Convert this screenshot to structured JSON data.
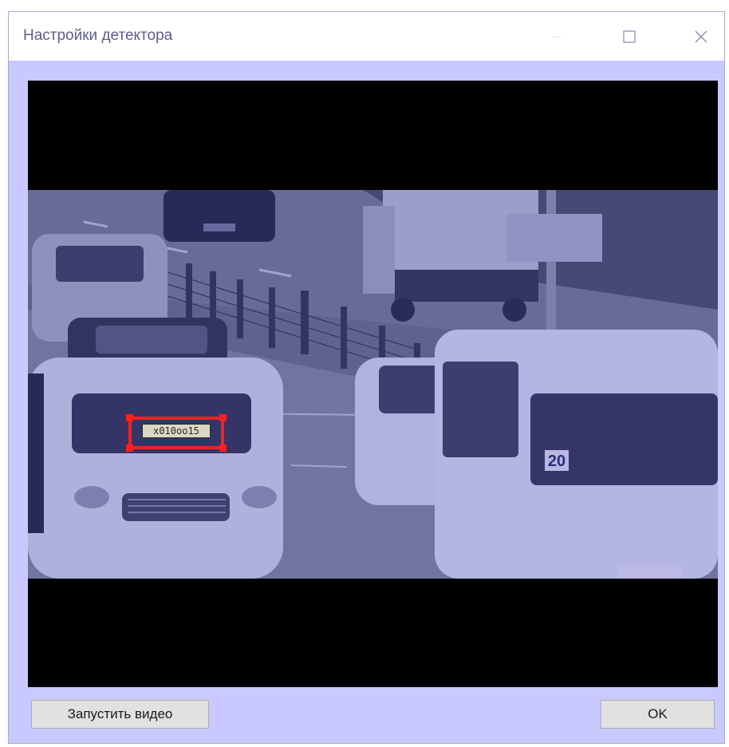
{
  "window": {
    "title": "Настройки детектора"
  },
  "titlebar_icons": [
    "minimize-icon",
    "maximize-icon",
    "close-icon"
  ],
  "video": {
    "plate_text": "x010oo15",
    "bus_number": "20",
    "roi_color": "#ff1e1e",
    "tint_color": "#4646c8"
  },
  "buttons": {
    "start_video": "Запустить видео",
    "ok": "OK"
  }
}
